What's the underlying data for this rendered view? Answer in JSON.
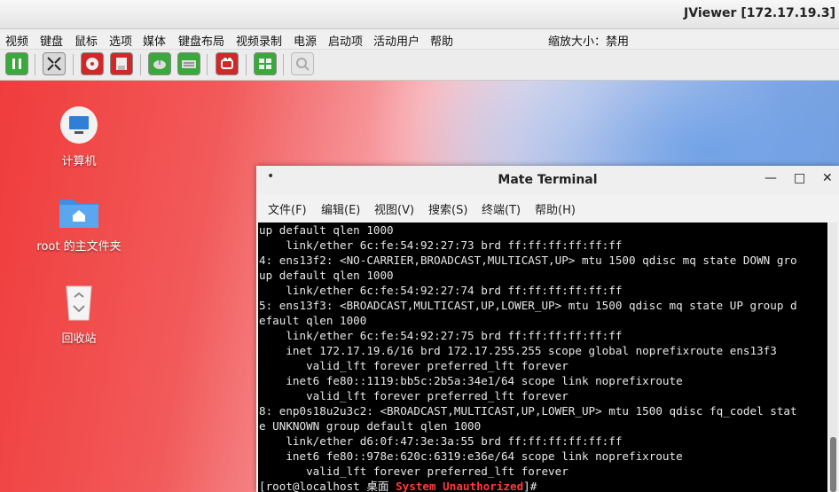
{
  "window": {
    "title": "JViewer [172.17.19.3]"
  },
  "menu": {
    "items": [
      "视频",
      "键盘",
      "鼠标",
      "选项",
      "媒体",
      "键盘布局",
      "视频录制",
      "电源",
      "启动项",
      "活动用户",
      "帮助"
    ],
    "zoom_label": "缩放大小：禁用"
  },
  "toolbar": {
    "buttons": [
      {
        "icon": "pause-icon",
        "color": "#3aa83a"
      },
      {
        "icon": "fullscreen-icon",
        "color": "#d8d8d8"
      },
      {
        "icon": "cd-media-icon",
        "color": "#d02828"
      },
      {
        "icon": "floppy-media-icon",
        "color": "#d02828"
      },
      {
        "icon": "mouse-icon",
        "color": "#3aa83a"
      },
      {
        "icon": "keyboard-icon",
        "color": "#3aa83a"
      },
      {
        "icon": "video-record-icon",
        "color": "#d02828"
      },
      {
        "icon": "active-users-icon",
        "color": "#3aa83a"
      },
      {
        "icon": "zoom-icon",
        "color": "#e6e6e6"
      }
    ]
  },
  "desktop": {
    "icons": [
      {
        "name": "computer-icon",
        "label": "计算机"
      },
      {
        "name": "home-folder-icon",
        "label": "root 的主文件夹"
      },
      {
        "name": "trash-icon",
        "label": "回收站"
      }
    ]
  },
  "terminal": {
    "title": "Mate Terminal",
    "title_dot": "•",
    "controls": {
      "minimize": "—",
      "maximize": "□",
      "close": "✕"
    },
    "menu": [
      "文件(F)",
      "编辑(E)",
      "视图(V)",
      "搜索(S)",
      "终端(T)",
      "帮助(H)"
    ],
    "lines": [
      "up default qlen 1000",
      "    link/ether 6c:fe:54:92:27:73 brd ff:ff:ff:ff:ff:ff",
      "4: ens13f2: <NO-CARRIER,BROADCAST,MULTICAST,UP> mtu 1500 qdisc mq state DOWN gro",
      "up default qlen 1000",
      "    link/ether 6c:fe:54:92:27:74 brd ff:ff:ff:ff:ff:ff",
      "5: ens13f3: <BROADCAST,MULTICAST,UP,LOWER_UP> mtu 1500 qdisc mq state UP group d",
      "efault qlen 1000",
      "    link/ether 6c:fe:54:92:27:75 brd ff:ff:ff:ff:ff:ff",
      "    inet 172.17.19.6/16 brd 172.17.255.255 scope global noprefixroute ens13f3",
      "       valid_lft forever preferred_lft forever",
      "    inet6 fe80::1119:bb5c:2b5a:34e1/64 scope link noprefixroute",
      "       valid_lft forever preferred_lft forever",
      "8: enp0s18u2u3c2: <BROADCAST,MULTICAST,UP,LOWER_UP> mtu 1500 qdisc fq_codel stat",
      "e UNKNOWN group default qlen 1000",
      "    link/ether d6:0f:47:3e:3a:55 brd ff:ff:ff:ff:ff:ff",
      "    inet6 fe80::978e:620c:6319:e36e/64 scope link noprefixroute",
      "       valid_lft forever preferred_lft forever"
    ],
    "prompt": {
      "user": "[root@localhost 桌面 ",
      "warning": "System Unauthorized",
      "end": "]#"
    }
  }
}
